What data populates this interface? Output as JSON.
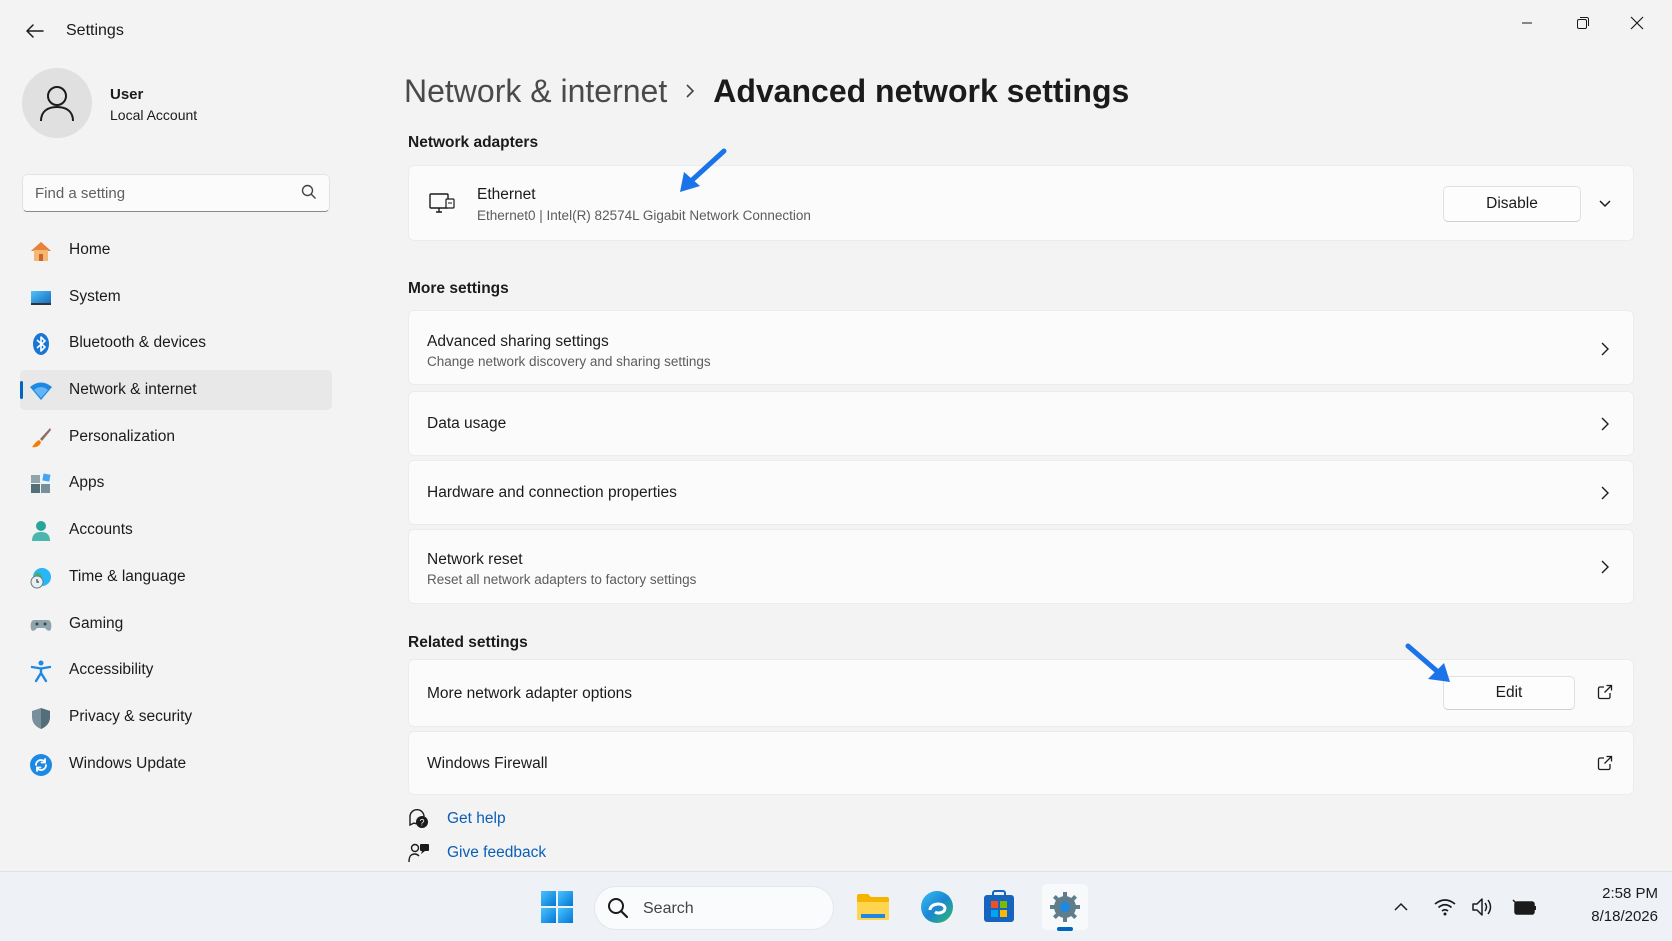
{
  "window": {
    "title": "Settings",
    "controls": {
      "minimize": "minimize-icon",
      "maximize": "restore-icon",
      "close": "close-icon"
    }
  },
  "user": {
    "name": "User",
    "account_type": "Local Account"
  },
  "search": {
    "placeholder": "Find a setting"
  },
  "nav": {
    "items": [
      {
        "label": "Home",
        "icon": "home-icon"
      },
      {
        "label": "System",
        "icon": "system-icon"
      },
      {
        "label": "Bluetooth & devices",
        "icon": "bluetooth-icon"
      },
      {
        "label": "Network & internet",
        "icon": "network-icon",
        "selected": true
      },
      {
        "label": "Personalization",
        "icon": "brush-icon"
      },
      {
        "label": "Apps",
        "icon": "apps-icon"
      },
      {
        "label": "Accounts",
        "icon": "accounts-icon"
      },
      {
        "label": "Time & language",
        "icon": "globe-clock-icon"
      },
      {
        "label": "Gaming",
        "icon": "gamepad-icon"
      },
      {
        "label": "Accessibility",
        "icon": "accessibility-icon"
      },
      {
        "label": "Privacy & security",
        "icon": "shield-icon"
      },
      {
        "label": "Windows Update",
        "icon": "update-icon"
      }
    ]
  },
  "breadcrumb": {
    "parent": "Network & internet",
    "current": "Advanced network settings"
  },
  "sections": {
    "adapters": {
      "title": "Network adapters",
      "adapter": {
        "name": "Ethernet",
        "description": "Ethernet0 | Intel(R) 82574L Gigabit Network Connection",
        "button_label": "Disable"
      }
    },
    "more_settings": {
      "title": "More settings",
      "items": [
        {
          "title": "Advanced sharing settings",
          "subtitle": "Change network discovery and sharing settings"
        },
        {
          "title": "Data usage",
          "subtitle": ""
        },
        {
          "title": "Hardware and connection properties",
          "subtitle": ""
        },
        {
          "title": "Network reset",
          "subtitle": "Reset all network adapters to factory settings"
        }
      ]
    },
    "related": {
      "title": "Related settings",
      "items": [
        {
          "title": "More network adapter options",
          "button_label": "Edit"
        },
        {
          "title": "Windows Firewall"
        }
      ]
    }
  },
  "help": {
    "get_help": "Get help",
    "give_feedback": "Give feedback"
  },
  "taskbar": {
    "search_label": "Search",
    "apps": [
      "start-icon",
      "file-explorer-icon",
      "edge-icon",
      "store-icon",
      "settings-icon"
    ],
    "tray": [
      "chevron-up-icon",
      "wifi-icon",
      "volume-icon",
      "battery-icon"
    ],
    "time": "2:58 PM",
    "date": "8/18/2026"
  },
  "colors": {
    "accent": "#0067c0",
    "annotation_arrow": "#1a73e8",
    "link": "#0a5fb4"
  }
}
